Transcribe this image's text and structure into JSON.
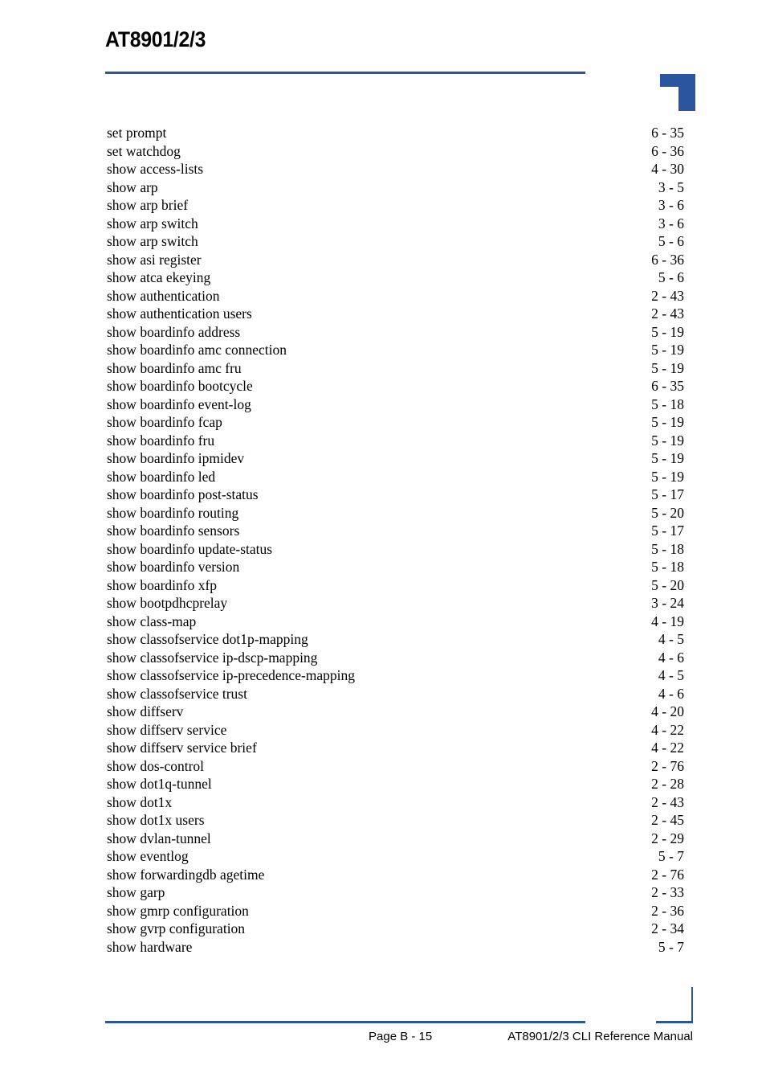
{
  "document": {
    "header_title": "AT8901/2/3",
    "accent_color": "#2C55A0"
  },
  "footer": {
    "page_number": "Page B - 15",
    "manual_title": "AT8901/2/3 CLI Reference Manual"
  },
  "index": {
    "entries": [
      {
        "label": "set prompt",
        "page": "6 - 35"
      },
      {
        "label": "set watchdog",
        "page": "6 - 36"
      },
      {
        "label": "show access-lists",
        "page": "4 - 30"
      },
      {
        "label": "show arp",
        "page": "3 - 5"
      },
      {
        "label": "show arp brief",
        "page": "3 - 6"
      },
      {
        "label": "show arp switch",
        "page": "3 - 6"
      },
      {
        "label": "show arp switch",
        "page": "5 - 6"
      },
      {
        "label": "show asi register",
        "page": "6 - 36"
      },
      {
        "label": "show atca ekeying",
        "page": "5 - 6"
      },
      {
        "label": "show authentication",
        "page": "2 - 43"
      },
      {
        "label": "show authentication users",
        "page": "2 - 43"
      },
      {
        "label": "show boardinfo address",
        "page": "5 - 19"
      },
      {
        "label": "show boardinfo amc connection",
        "page": "5 - 19"
      },
      {
        "label": "show boardinfo amc fru",
        "page": "5 - 19"
      },
      {
        "label": "show boardinfo bootcycle",
        "page": "6 - 35"
      },
      {
        "label": "show boardinfo event-log",
        "page": "5 - 18"
      },
      {
        "label": "show boardinfo fcap",
        "page": "5 - 19"
      },
      {
        "label": "show boardinfo fru",
        "page": "5 - 19"
      },
      {
        "label": "show boardinfo ipmidev",
        "page": "5 - 19"
      },
      {
        "label": "show boardinfo led",
        "page": "5 - 19"
      },
      {
        "label": "show boardinfo post-status",
        "page": "5 - 17"
      },
      {
        "label": "show boardinfo routing",
        "page": "5 - 20"
      },
      {
        "label": "show boardinfo sensors",
        "page": "5 - 17"
      },
      {
        "label": "show boardinfo update-status",
        "page": "5 - 18"
      },
      {
        "label": "show boardinfo version",
        "page": "5 - 18"
      },
      {
        "label": "show boardinfo xfp",
        "page": "5 - 20"
      },
      {
        "label": "show bootpdhcprelay",
        "page": "3 - 24"
      },
      {
        "label": "show class-map",
        "page": "4 - 19"
      },
      {
        "label": "show classofservice dot1p-mapping",
        "page": "4 - 5"
      },
      {
        "label": "show classofservice ip-dscp-mapping",
        "page": "4 - 6"
      },
      {
        "label": "show classofservice ip-precedence-mapping",
        "page": "4 - 5"
      },
      {
        "label": "show classofservice trust",
        "page": "4 - 6"
      },
      {
        "label": "show diffserv",
        "page": "4 - 20"
      },
      {
        "label": "show diffserv service",
        "page": "4 - 22"
      },
      {
        "label": "show diffserv service brief",
        "page": "4 - 22"
      },
      {
        "label": "show dos-control",
        "page": "2 - 76"
      },
      {
        "label": "show dot1q-tunnel",
        "page": "2 - 28"
      },
      {
        "label": "show dot1x",
        "page": "2 - 43"
      },
      {
        "label": "show dot1x users",
        "page": "2 - 45"
      },
      {
        "label": "show dvlan-tunnel",
        "page": "2 - 29"
      },
      {
        "label": "show eventlog",
        "page": "5 - 7"
      },
      {
        "label": "show forwardingdb agetime",
        "page": "2 - 76"
      },
      {
        "label": "show garp",
        "page": "2 - 33"
      },
      {
        "label": "show gmrp configuration",
        "page": "2 - 36"
      },
      {
        "label": "show gvrp configuration",
        "page": "2 - 34"
      },
      {
        "label": "show hardware",
        "page": "5 - 7"
      }
    ]
  }
}
